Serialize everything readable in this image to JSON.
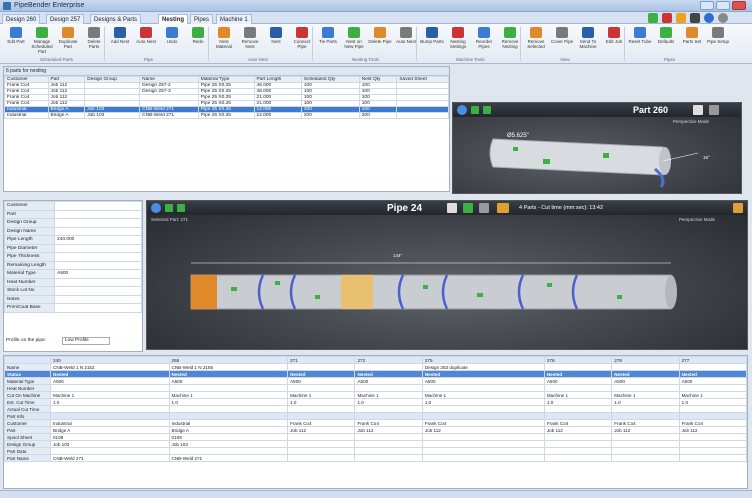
{
  "app": {
    "title": "PipeBender Enterprise"
  },
  "tabs": [
    "Design 260",
    "Design 257",
    "Designs & Parts",
    "Nesting",
    "Pipes",
    "Machine 1"
  ],
  "active_tab": 3,
  "ribbon": {
    "buttons": [
      "Edit Part",
      "Manage Scheduled Part",
      "Duplicate Part",
      "Delete Parts",
      "Add Nest",
      "Auto Nest",
      "Undo",
      "Redo",
      "Nest Material",
      "Remove Nest",
      "Nest",
      "Connect Pipe",
      "Tie Parts",
      "Nest on New Pipe",
      "Delete Pipe",
      "Auto Nest",
      "Bump Parts",
      "Nesting Settings",
      "Reorder Pipes",
      "Remove Nesting",
      "Remove Selected",
      "Cover Pipe",
      "Send To Machine",
      "Edit Job",
      "Reset Tube",
      "Defaults",
      "Parts Set",
      "Pipe Setup"
    ],
    "groups": [
      "Scheduled Parts",
      "Pipe",
      "Auto Nest",
      "Nesting Tools",
      "Machine Tools",
      "View",
      "Pipes"
    ]
  },
  "parts": {
    "header": "6 parts for nesting",
    "columns": [
      "Customer",
      "Part",
      "Design Group",
      "Name",
      "Material Type",
      "Part Length",
      "Scheduled Qty",
      "Nest Qty",
      "Saved Sheet"
    ],
    "rows": [
      [
        "Frank Co4",
        "Job 112",
        "",
        "Design 257-2",
        "Pipe 25 X0.25",
        "46.000",
        "100",
        "100"
      ],
      [
        "Frank Co4",
        "Job 112",
        "",
        "Design 257-3",
        "Pipe 25 X0.25",
        "46.000",
        "100",
        "100"
      ],
      [
        "Frank Co4",
        "Job 112",
        "",
        "",
        "Pipe 25 X0.25",
        "21.000",
        "100",
        "100"
      ],
      [
        "Frank Co4",
        "Job 112",
        "",
        "",
        "Pipe 25 X0.25",
        "21.000",
        "100",
        "100"
      ],
      [
        "Industrial",
        "Bridge A",
        "Job 103",
        "CNB-Weld 271",
        "Pipe 25 X0.25",
        "12.000",
        "200",
        "100"
      ],
      [
        "Industrial",
        "Bridge A",
        "Job 103",
        "CNB-Weld 271",
        "Pipe 25 X0.25",
        "12.000",
        "200",
        "200"
      ]
    ],
    "selected_row": 4
  },
  "part_viewer": {
    "title": "Part 260",
    "dim": "Ø5.625\"",
    "angle": "15°",
    "view": "Perspective Mode"
  },
  "props": {
    "rows": [
      [
        "Customer",
        ""
      ],
      [
        "Part",
        ""
      ],
      [
        "Design Group",
        ""
      ],
      [
        "Design Name",
        ""
      ],
      [
        "Pipe Length",
        "240.000"
      ],
      [
        "Pipe Diameter",
        ""
      ],
      [
        "Pipe Thickness",
        ""
      ],
      [
        "Remaining Length",
        ""
      ],
      [
        "Material Type",
        "A500"
      ],
      [
        "Heat Number",
        ""
      ],
      [
        "Stock Lot No",
        ""
      ],
      [
        "Notes",
        ""
      ],
      [
        "Prim/Coat Base",
        ""
      ]
    ],
    "profile_label": "Profile on the pipe:",
    "profile_value": "Low Profile"
  },
  "pipe_viewer": {
    "title": "Pipe 24",
    "parts_info": "4 Parts - Cut time (mm:sec): 13:42",
    "subtitle": "Selected Part: 271",
    "length_label": "144\"",
    "view": "Perspective Mode"
  },
  "grid": {
    "header_cols": [
      "240",
      "265",
      "271",
      "272",
      "275",
      "276",
      "278",
      "277"
    ],
    "rows": [
      {
        "label": "Name",
        "cells": [
          "CNB-Weld 1 N 2152",
          "CNB-Weld 1 N 2155",
          "",
          "",
          "Design 253 duplicate",
          "",
          "",
          ""
        ]
      },
      {
        "label": "Status",
        "cells": [
          "Nested",
          "Nested",
          "Nested",
          "Nested",
          "Nested",
          "Nested",
          "Nested",
          "Nested"
        ],
        "style": "blue"
      },
      {
        "label": "Material Type",
        "cells": [
          "A500",
          "A500",
          "A500",
          "A500",
          "A500",
          "A500",
          "A500",
          "A500"
        ]
      },
      {
        "label": "Heat Number",
        "cells": [
          "",
          "",
          "",
          "",
          "",
          "",
          "",
          ""
        ]
      },
      {
        "label": "Cut On Machine",
        "cells": [
          "Machine 1",
          "Machine 1",
          "Machine 1",
          "Machine 1",
          "Machine 1",
          "Machine 1",
          "Machine 1",
          "Machine 1"
        ]
      },
      {
        "label": "Est. Cut Time",
        "cells": [
          "1.0",
          "1.0",
          "1.0",
          "1.0",
          "1.0",
          "1.0",
          "1.0",
          "1.0"
        ]
      },
      {
        "label": "Actual Cut Time",
        "cells": [
          "",
          "",
          "",
          "",
          "",
          "",
          "",
          ""
        ]
      },
      {
        "label": "Part Info",
        "cells": [
          "",
          "",
          "",
          "",
          "",
          "",
          "",
          ""
        ],
        "style": "lb"
      },
      {
        "label": "Customer",
        "cells": [
          "Industrial",
          "Industrial",
          "Frank Co4",
          "Frank Co4",
          "Frank Co4",
          "Frank Co4",
          "Frank Co4",
          "Frank Co4"
        ]
      },
      {
        "label": "Part",
        "cells": [
          "Bridge A",
          "Bridge A",
          "Job 112",
          "Job 112",
          "Job 112",
          "Job 112",
          "Job 112",
          "Job 112"
        ]
      },
      {
        "label": "Spool Sheet",
        "cells": [
          "0108",
          "0108",
          "",
          "",
          "",
          "",
          "",
          ""
        ]
      },
      {
        "label": "Design Group",
        "cells": [
          "Job 103",
          "Job 103",
          "",
          "",
          "",
          "",
          "",
          ""
        ]
      },
      {
        "label": "Part Data",
        "cells": [
          "",
          "",
          "",
          "",
          "",
          "",
          "",
          ""
        ]
      },
      {
        "label": "Part Name",
        "cells": [
          "CNB-Weld 271",
          "CNB-Weld 271",
          "",
          "",
          "",
          "",
          "",
          ""
        ]
      }
    ]
  },
  "colors": {
    "accent": "#3d7bd0",
    "ribbon": "#e3eaf3",
    "viewer": "#3a3f48",
    "orange": "#e0892a",
    "green": "#3cb043"
  }
}
